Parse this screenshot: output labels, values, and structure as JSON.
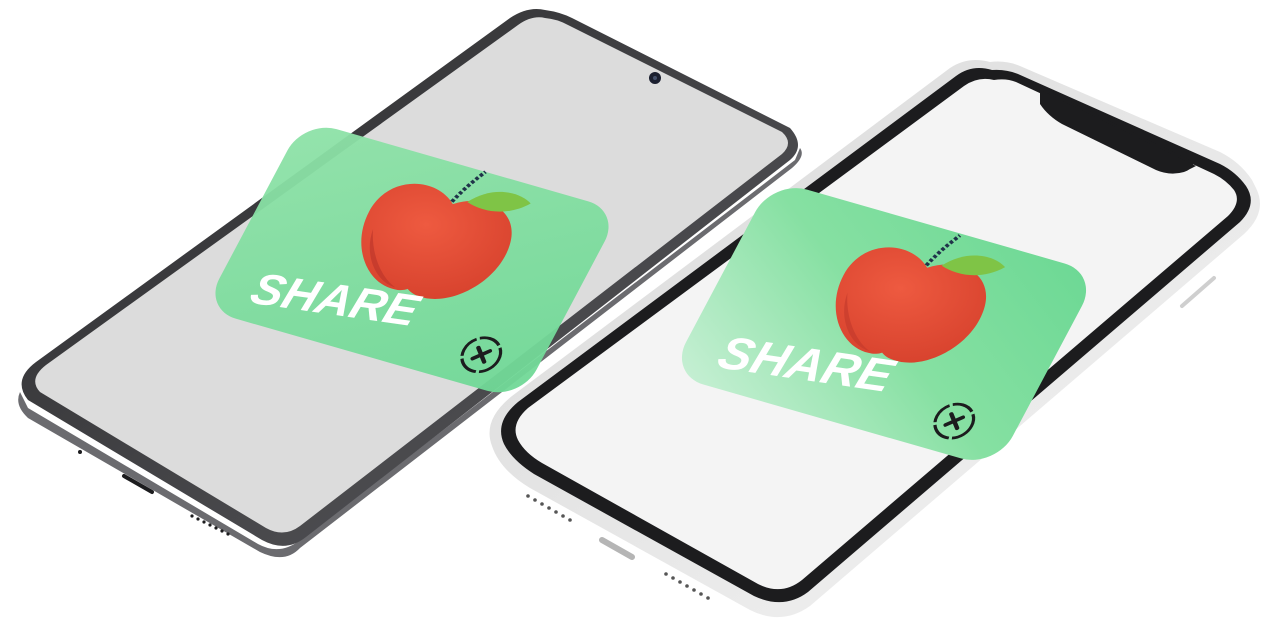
{
  "scene": {
    "description_free": true
  },
  "colors": {
    "background": "#ffffff",
    "android_body": "#3a3a3c",
    "android_screen": "#dedede",
    "iphone_body": "#1c1c1e",
    "iphone_frame": "#e9e9e9",
    "iphone_screen": "#f4f4f4",
    "icon_green_light": "#9be3b3",
    "icon_green": "#63d58c",
    "apple_red": "#e24a34",
    "apple_red_dark": "#b9332a",
    "leaf_green": "#7bbf3d",
    "stem": "#20344a",
    "share_text": "#ffffff"
  },
  "phones": [
    {
      "id": "android",
      "icon": "app-icon",
      "app_label": "SHARE"
    },
    {
      "id": "iphone",
      "icon": "app-icon",
      "app_label": "SHARE"
    }
  ]
}
